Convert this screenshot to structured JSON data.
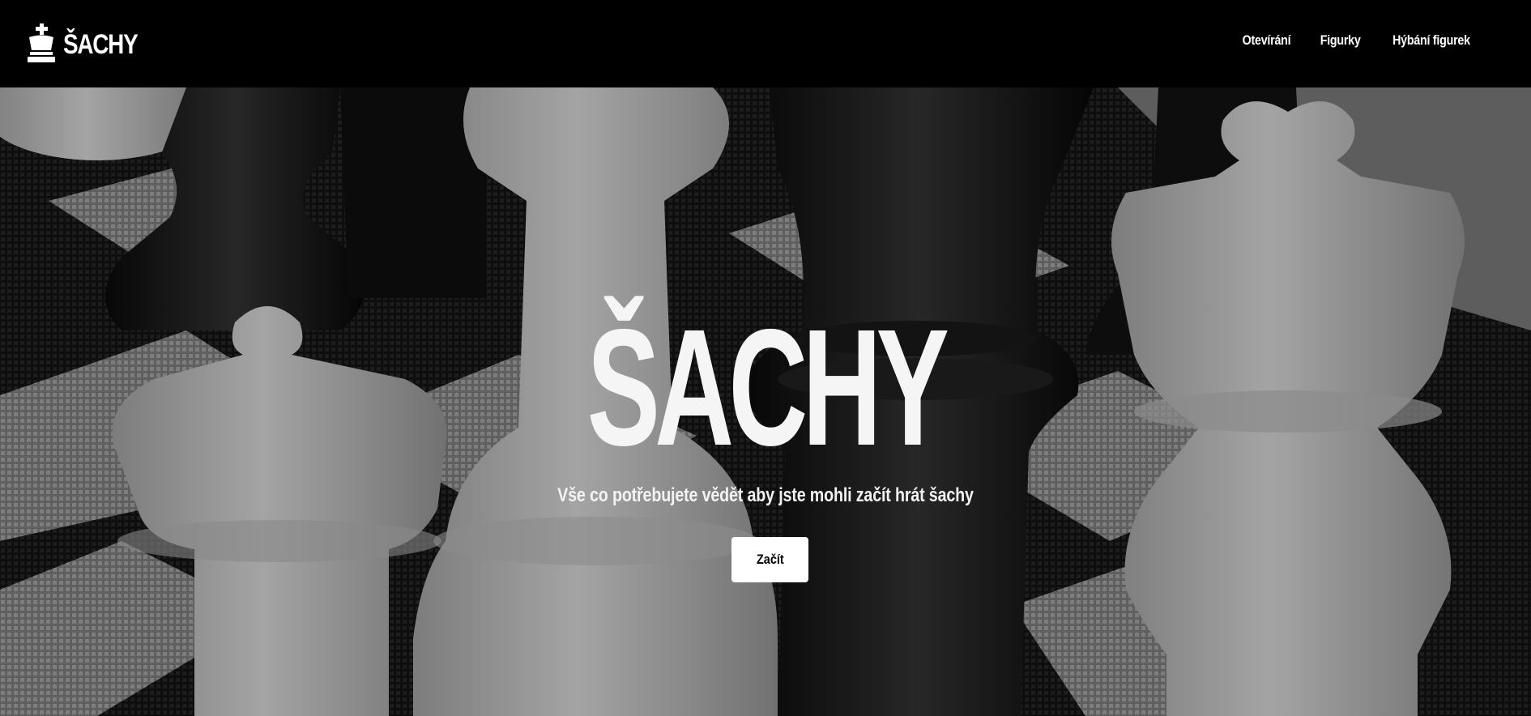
{
  "header": {
    "brand": {
      "icon": "chess-king-icon",
      "text": "ŠACHY"
    },
    "nav": [
      {
        "label": "Otevírání"
      },
      {
        "label": "Figurky"
      },
      {
        "label": "Hýbání figurek"
      }
    ]
  },
  "hero": {
    "background": "grayscale photo of large chess pieces on a checkered board",
    "title": "ŠACHY",
    "subtitle": "Vše co potřebujete vědět aby jste mohli začít hrát šachy",
    "cta_label": "Začít"
  },
  "colors": {
    "header_bg": "#000000",
    "text": "#ffffff",
    "button_bg": "#ffffff",
    "button_text": "#000000"
  }
}
